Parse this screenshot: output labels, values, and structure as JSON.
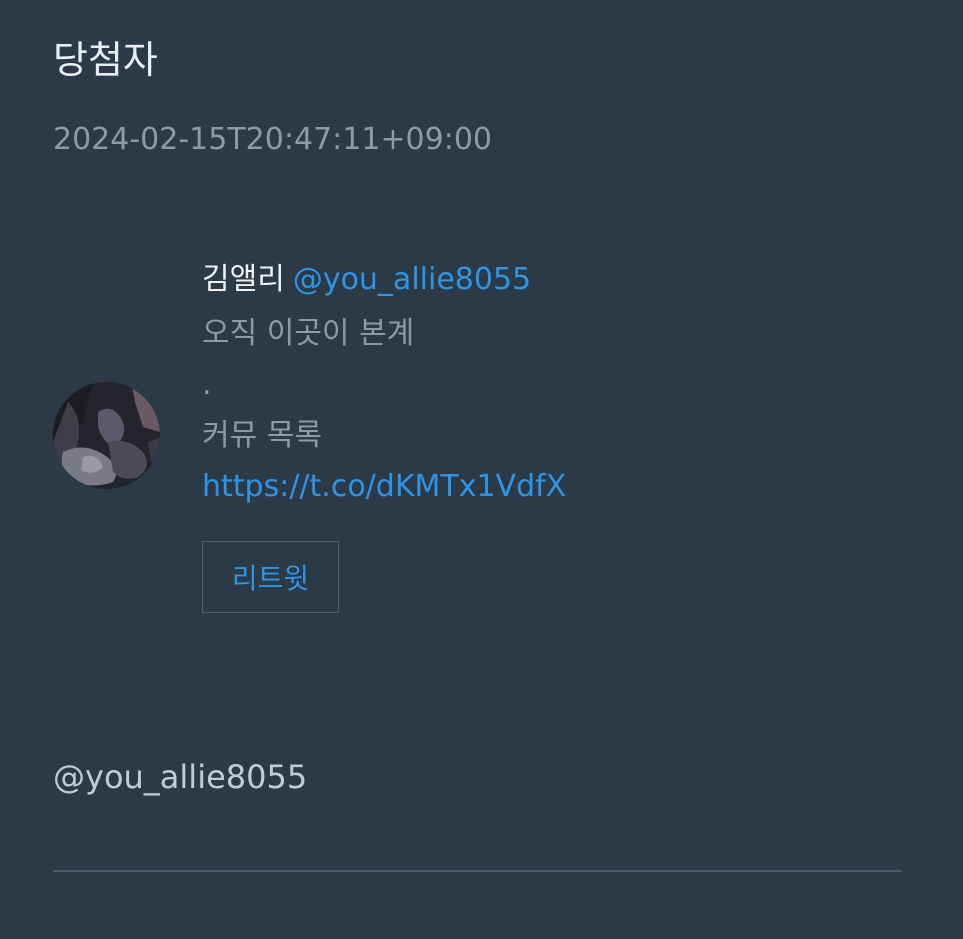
{
  "header": {
    "title": "당첨자",
    "timestamp": "2024-02-15T20:47:11+09:00"
  },
  "winner": {
    "avatar_icon": "profile-avatar",
    "display_name": "김앨리",
    "handle": "@you_allie8055",
    "bio_lines": [
      "오직 이곳이 본계",
      ".",
      "커뮤 목록"
    ],
    "link": "https://t.co/dKMTx1VdfX",
    "retweet_label": "리트윗"
  },
  "mention": "@you_allie8055",
  "colors": {
    "background": "#2c3a47",
    "accent": "#2e95e6",
    "muted_text": "#8c9ba6",
    "divider": "#4a5a68"
  }
}
